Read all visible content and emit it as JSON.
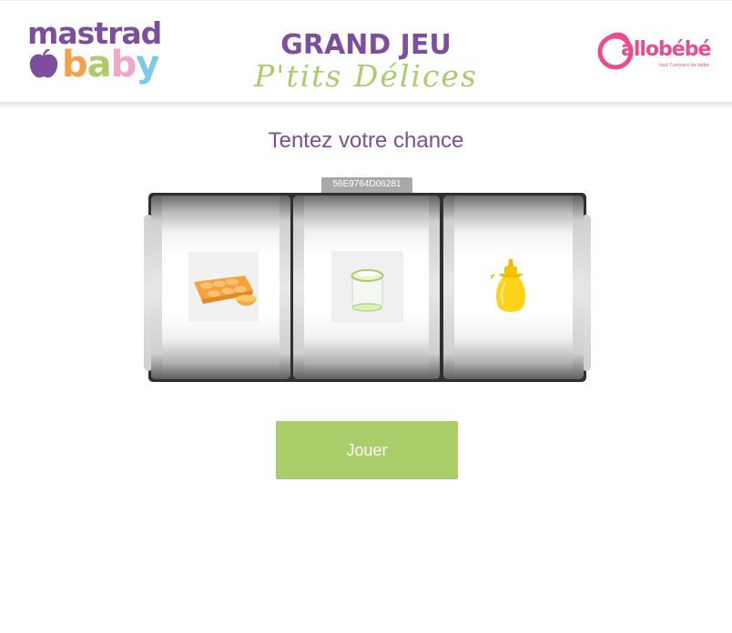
{
  "header": {
    "brand_left": {
      "line1": "mastrad",
      "line2": "baby"
    },
    "title": "GRAND JEU",
    "title_script": "P'tits Délices",
    "brand_right": {
      "name": "allobébé",
      "tagline": "tout l'univers de bébé"
    }
  },
  "game": {
    "heading": "Tentez votre chance",
    "code": "56E9764D06281",
    "reels": [
      {
        "item": "orange-silicone-mold-icon"
      },
      {
        "item": "glass-jar-green-lid-icon"
      },
      {
        "item": "yellow-squeeze-bottle-icon"
      }
    ],
    "play_label": "Jouer"
  },
  "colors": {
    "brand_purple": "#7d4e9e",
    "brand_green": "#aacc69",
    "brand_pink": "#ec4b8d",
    "brand_orange": "#f5a04a",
    "brand_blue": "#7ec9ea"
  }
}
